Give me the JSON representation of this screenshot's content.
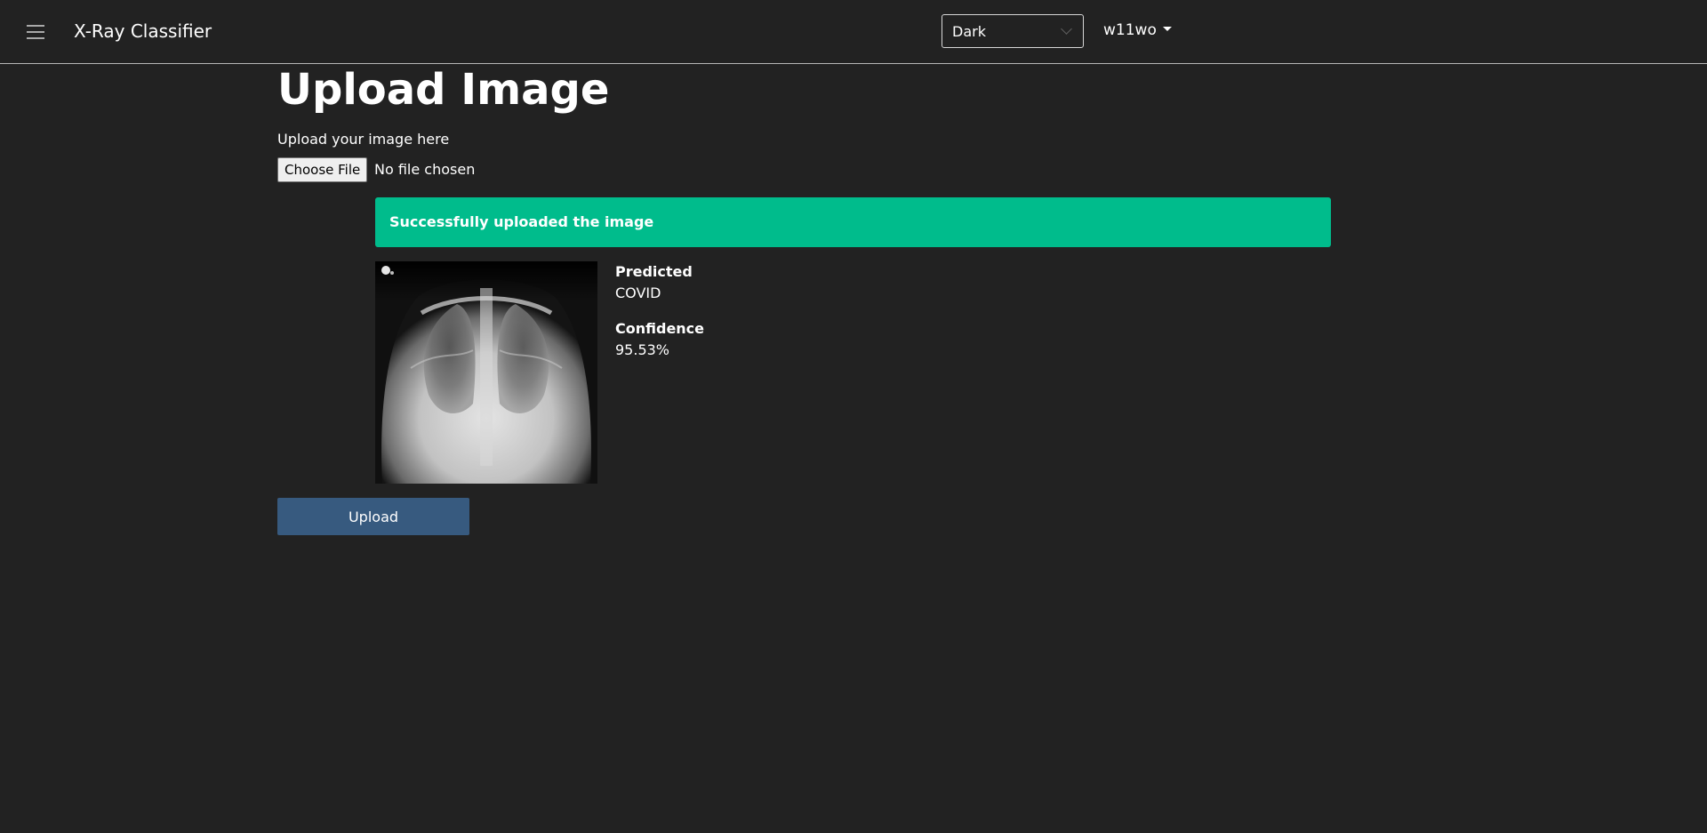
{
  "header": {
    "menu_icon": "hamburger-icon",
    "brand": "X-Ray Classifier",
    "theme_select": {
      "value": "Dark",
      "icon": "chevron-down-icon"
    },
    "user_menu": {
      "label": "w11wo",
      "icon": "caret-down-icon"
    }
  },
  "main": {
    "title": "Upload Image",
    "upload_label": "Upload your image here",
    "file_input": {
      "button_label": "Choose File",
      "status": "No file chosen"
    },
    "alert": {
      "message": "Successfully uploaded the image",
      "color": "#00bc8c"
    },
    "result": {
      "predicted_label": "Predicted",
      "predicted_value": "COVID",
      "confidence_label": "Confidence",
      "confidence_value": "95.53%"
    },
    "upload_button": {
      "label": "Upload",
      "color": "#375a7f"
    }
  },
  "colors": {
    "background": "#222222",
    "text": "#ffffff"
  }
}
